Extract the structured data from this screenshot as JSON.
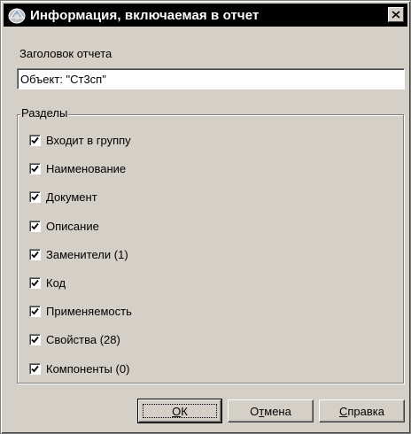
{
  "window": {
    "title": "Информация, включаемая в отчет",
    "close_glyph": "×",
    "icon": "window-app-icon"
  },
  "header": {
    "label": "Заголовок отчета",
    "value": "Объект: \"Ст3сп\""
  },
  "sections": {
    "label": "Разделы",
    "items": [
      {
        "label": "Входит в группу",
        "checked": true
      },
      {
        "label": "Наименование",
        "checked": true
      },
      {
        "label": "Документ",
        "checked": true
      },
      {
        "label": "Описание",
        "checked": true
      },
      {
        "label": "Заменители (1)",
        "checked": true
      },
      {
        "label": "Код",
        "checked": true
      },
      {
        "label": "Применяемость",
        "checked": true
      },
      {
        "label": "Свойства (28)",
        "checked": true
      },
      {
        "label": "Компоненты (0)",
        "checked": true
      }
    ]
  },
  "buttons": {
    "ok": {
      "pre": "",
      "accel": "О",
      "post": "К"
    },
    "cancel": {
      "pre": "О",
      "accel": "т",
      "post": "мена"
    },
    "help": {
      "pre": "",
      "accel": "С",
      "post": "правка"
    }
  }
}
